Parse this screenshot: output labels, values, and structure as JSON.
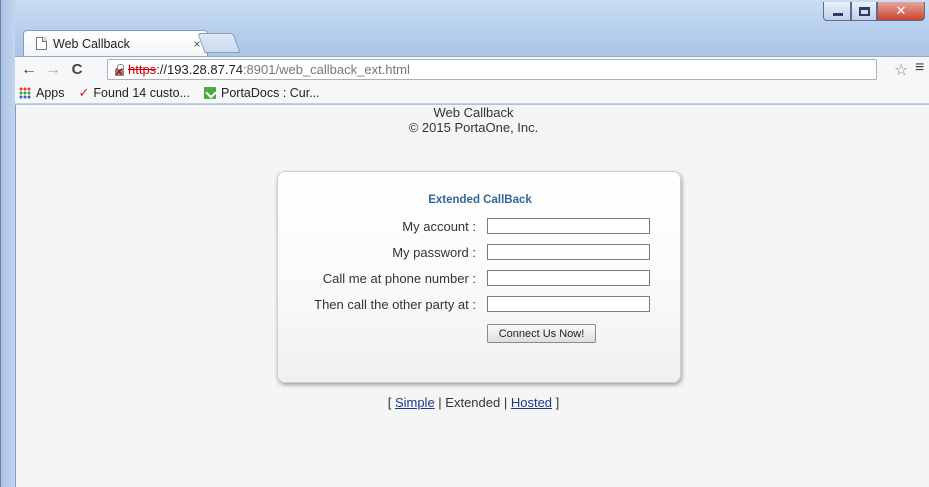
{
  "browser": {
    "tab_title": "Web Callback",
    "tab_close": "×",
    "url_scheme": "https",
    "url_host": "://193.28.87.74",
    "url_path": ":8901/web_callback_ext.html"
  },
  "bookmarks": [
    {
      "label": "Apps"
    },
    {
      "label": "Found 14 custo..."
    },
    {
      "label": "PortaDocs : Cur..."
    }
  ],
  "page": {
    "title": "Web Callback",
    "copyright": "© 2015 PortaOne, Inc.",
    "form": {
      "heading": "Extended CallBack",
      "fields": [
        {
          "label": "My account :",
          "value": ""
        },
        {
          "label": "My password :",
          "value": ""
        },
        {
          "label": "Call me at phone number :",
          "value": ""
        },
        {
          "label": "Then call the other party at :",
          "value": ""
        }
      ],
      "submit_label": "Connect Us Now!"
    },
    "modes": {
      "open": "[ ",
      "simple": "Simple",
      "sep1": " | ",
      "extended": "Extended",
      "sep2": " | ",
      "hosted": "Hosted",
      "close": " ]"
    }
  }
}
